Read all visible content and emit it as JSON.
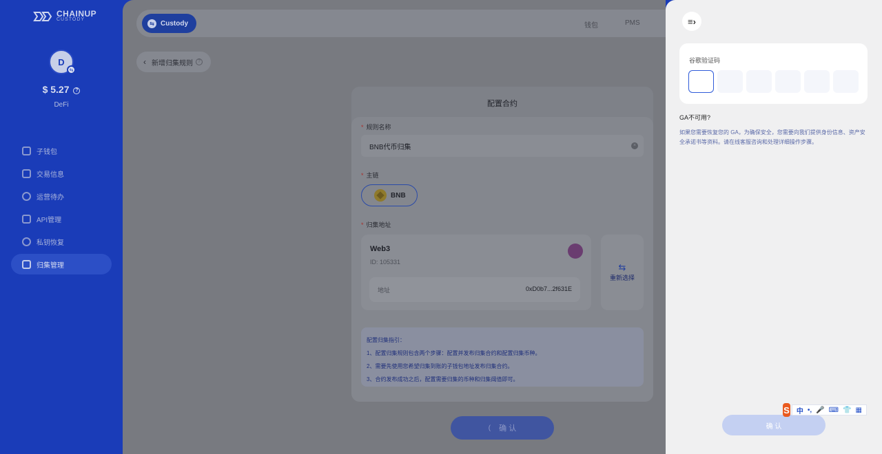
{
  "brand": {
    "name": "CHAINUP",
    "sub": "CUSTODY"
  },
  "account": {
    "initial": "D",
    "badge": "⇆",
    "balance": "$ 5.27",
    "name": "DeFi",
    "help": "?"
  },
  "sidebar": {
    "items": [
      {
        "label": "子钱包",
        "icon": "wallet-icon",
        "active": false
      },
      {
        "label": "交易信息",
        "icon": "transaction-icon",
        "active": false
      },
      {
        "label": "运营待办",
        "icon": "check-circle-icon",
        "active": false
      },
      {
        "label": "API管理",
        "icon": "api-icon",
        "active": false
      },
      {
        "label": "私钥恢复",
        "icon": "key-recovery-icon",
        "active": false
      },
      {
        "label": "归集管理",
        "icon": "collection-icon",
        "active": true
      }
    ]
  },
  "topbar": {
    "custody_label": "Custody",
    "custody_icon": "⇆",
    "links": [
      "钱包",
      "PMS"
    ]
  },
  "breadcrumb": {
    "back_icon": "‹",
    "label": "新增归集规则",
    "help": "?"
  },
  "form": {
    "title": "配置合约",
    "rule_name_label": "规则名称",
    "rule_name_value": "BNB代币归集",
    "clear_icon": "×",
    "chain_label": "主链",
    "chain_value": "BNB",
    "address_label": "归集地址",
    "wallet": {
      "name": "Web3",
      "id": "ID: 105331",
      "address_label": "地址",
      "address_value": "0xD0b7...2f631E"
    },
    "reselect_icon": "⇆",
    "reselect_label": "重新选择",
    "guide": {
      "title": "配置归集指引：",
      "lines": [
        "1、配置归集规则包含两个步骤：配置并发布归集合约和配置归集币种。",
        "2、需要先使用您希望归集到账的子钱包地址发布归集合约。",
        "3、合约发布成功之后，配置需要归集的币种和归集阈值即可。"
      ]
    },
    "confirm_spinner": "(",
    "confirm_label": "确 认"
  },
  "panel": {
    "menu_icon": "≡›",
    "ga_label": "谷歌验证码",
    "ga_unavailable": "GA不可用?",
    "ga_description": "如果您需要恢复您的 GA，为确保安全，您需要向我们提供身份信息、资产安全承诺书等资料。请在线客服咨询和处理详细操作步骤。",
    "confirm_label": "确 认"
  },
  "ime": {
    "logo": "S",
    "items": [
      "中",
      "•,",
      "🎤",
      "⌨",
      "👕",
      "▦"
    ]
  },
  "colors": {
    "sidebar": "#1a3cb8",
    "accent": "#2f5bd9",
    "required": "#d9534f"
  }
}
